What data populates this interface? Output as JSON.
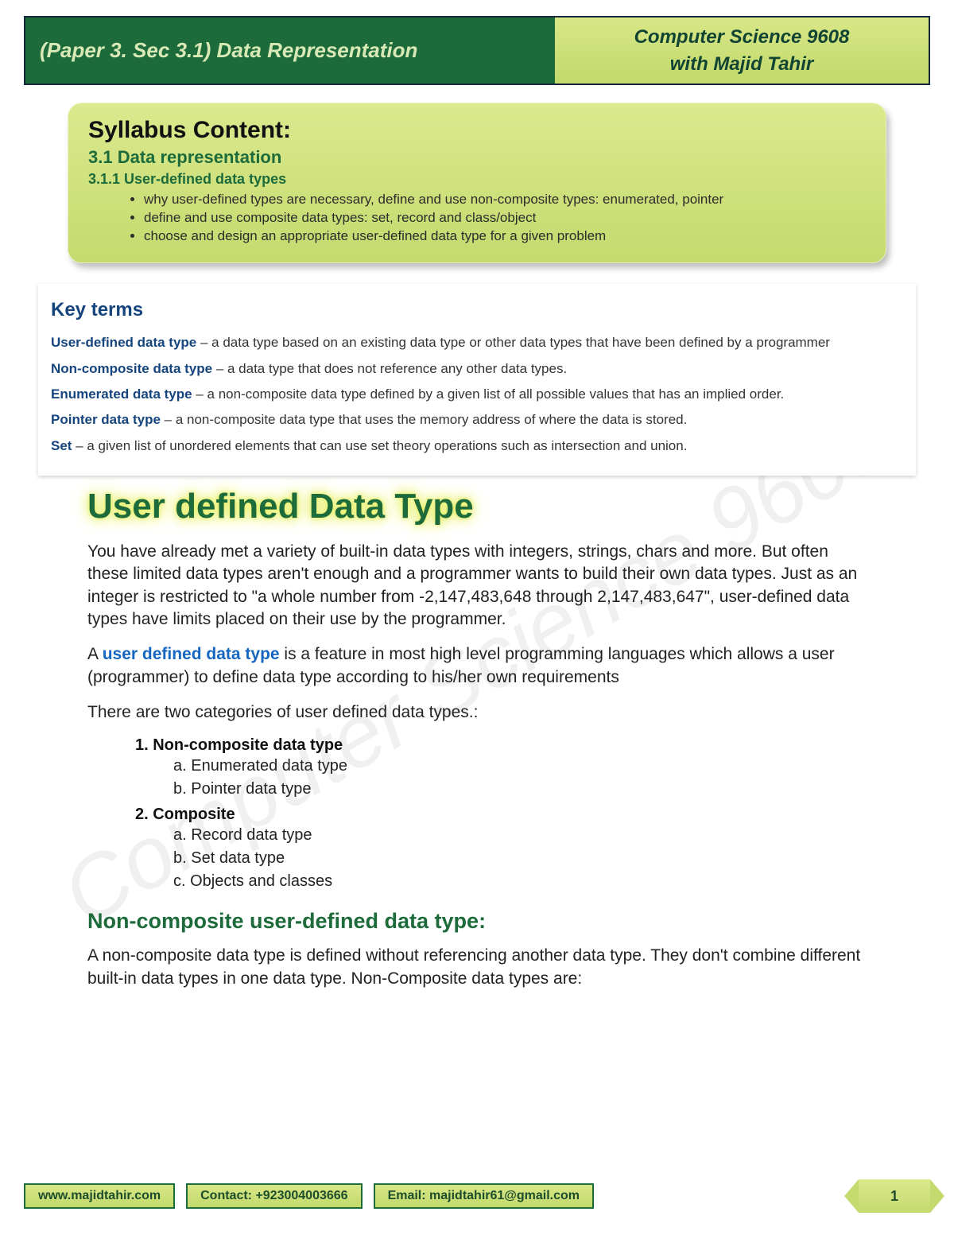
{
  "header": {
    "left": "(Paper 3. Sec 3.1) Data Representation",
    "right_line1": "Computer Science 9608",
    "right_line2": "with Majid Tahir"
  },
  "syllabus": {
    "title": "Syllabus Content:",
    "subtitle": "3.1 Data representation",
    "subsub": "3.1.1   User-defined data types",
    "bullets": [
      "why user-defined types are necessary, define and use non-composite types: enumerated, pointer",
      "define and use composite data types: set, record and class/object",
      "choose and design an appropriate user-defined data type for a given problem"
    ]
  },
  "keyterms": {
    "title": "Key terms",
    "items": [
      {
        "term": "User-defined data type",
        "def": " – a data type based on an existing data type or other data types that have been defined by a programmer"
      },
      {
        "term": "Non-composite data type",
        "def": " – a data type that does not reference any other data types."
      },
      {
        "term": "Enumerated data type",
        "def": " – a non-composite data type defined by a given list of all possible values that has an implied order."
      },
      {
        "term": "Pointer data type",
        "def": " – a non-composite data type that uses the memory address of where the data is stored."
      },
      {
        "term": "Set",
        "def": " – a given list of unordered elements that can use set theory operations such as intersection and union."
      }
    ]
  },
  "main": {
    "heading": "User defined Data Type",
    "para1": "You have already met a variety of built-in data types with integers, strings, chars and more. But often these limited data types aren't enough and a programmer wants to build their own data types. Just as an integer is restricted to \"a whole number from -2,147,483,648 through 2,147,483,647\", user-defined data types have limits placed on their use by the programmer.",
    "para2_prefix": "A ",
    "para2_link": "user defined data type",
    "para2_suffix": " is a feature in most high level programming languages which allows a user (programmer) to define data type according to his/her own requirements",
    "para3": "There are two categories of user defined data types.:",
    "list": {
      "one_label": "1.  Non-composite data type",
      "one_a": "a.  Enumerated data type",
      "one_b": "b.  Pointer data type",
      "two_label": "2.  Composite",
      "two_a": "a.  Record data type",
      "two_b": "b.  Set data type",
      "two_c": "c.  Objects and classes"
    },
    "section_h": "Non-composite user-defined data type:",
    "para4": "A non-composite data type is defined without referencing another data type. They don't combine different built-in data types in one data type. Non-Composite data types are:"
  },
  "watermark": "Computer Science 9608",
  "footer": {
    "website": "www.majidtahir.com",
    "contact": "Contact: +923004003666",
    "email": "Email: majidtahir61@gmail.com",
    "page": "1"
  }
}
